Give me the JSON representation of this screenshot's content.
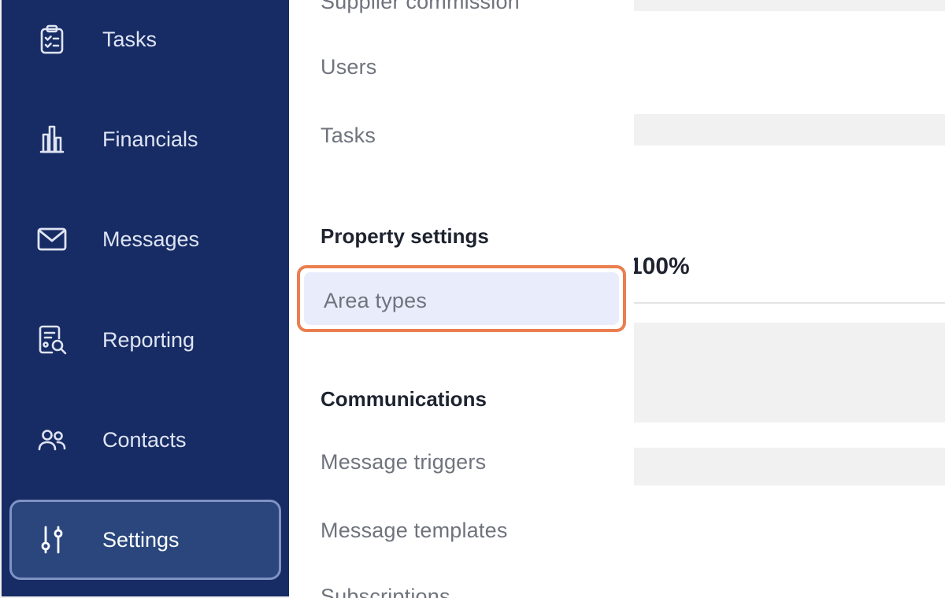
{
  "sidebar": {
    "items": [
      {
        "label": "Tasks",
        "icon": "clipboard-check-icon"
      },
      {
        "label": "Financials",
        "icon": "bar-chart-icon"
      },
      {
        "label": "Messages",
        "icon": "envelope-icon"
      },
      {
        "label": "Reporting",
        "icon": "report-search-icon"
      },
      {
        "label": "Contacts",
        "icon": "users-icon"
      },
      {
        "label": "Settings",
        "icon": "sliders-icon",
        "active": true
      }
    ]
  },
  "submenu": {
    "top_partial": "Supplier commission",
    "users": "Users",
    "tasks": "Tasks",
    "property_heading": "Property settings",
    "area_types": "Area types",
    "communications_heading": "Communications",
    "message_triggers": "Message triggers",
    "message_templates": "Message templates",
    "bottom_partial": "Subscriptions"
  },
  "content": {
    "percent": "100%"
  },
  "colors": {
    "sidebar_bg": "#172c65",
    "active_item_bg": "#2a467d",
    "highlight_border": "#ea7e4f",
    "highlight_bg": "#e9edfb"
  }
}
